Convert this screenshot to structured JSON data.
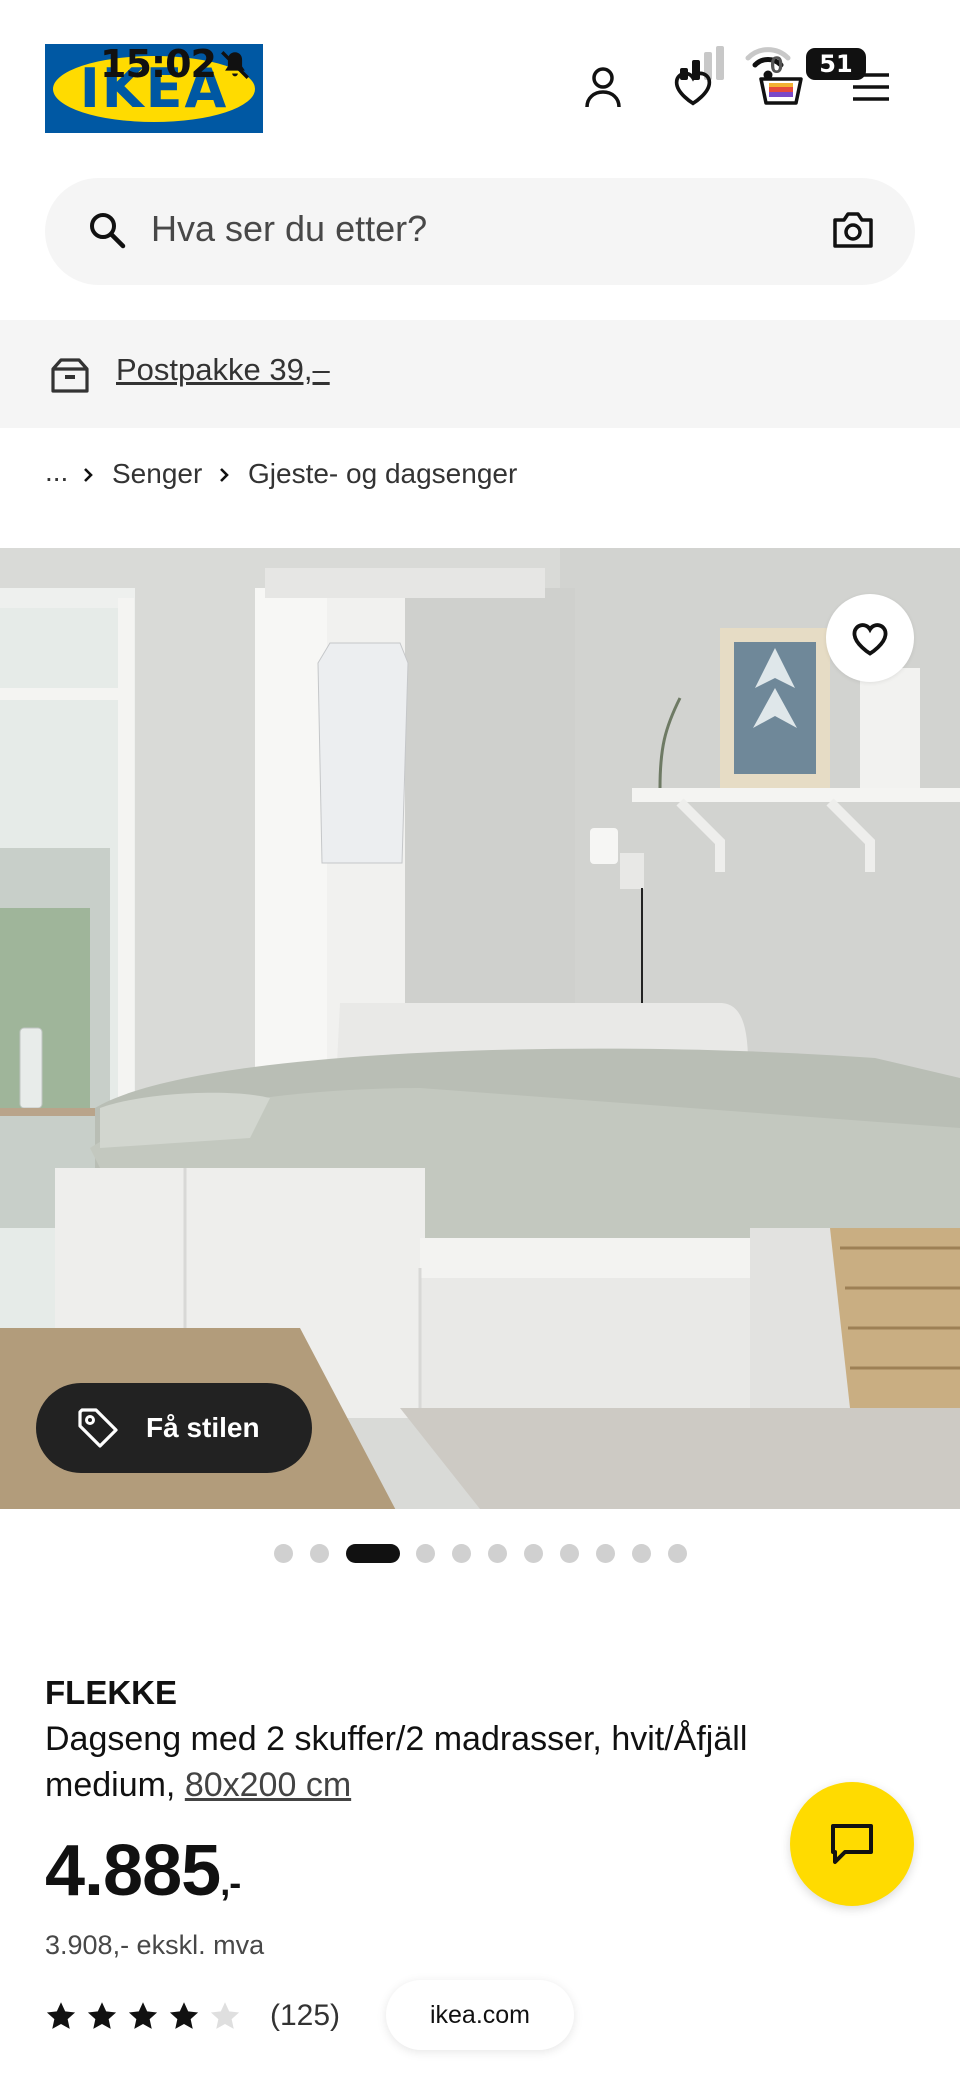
{
  "status_bar": {
    "time": "15:02",
    "battery": "51"
  },
  "header": {
    "logo_text": "IKEA",
    "cart_count": "0"
  },
  "search": {
    "placeholder": "Hva ser du etter?"
  },
  "banner": {
    "text": "Postpakke 39,–"
  },
  "breadcrumb": {
    "ellipsis": "...",
    "items": [
      "Senger",
      "Gjeste- og dagsenger"
    ]
  },
  "hero": {
    "style_button": "Få stilen",
    "dots_total": 11,
    "active_dot": 3
  },
  "product": {
    "name": "FLEKKE",
    "description": "Dagseng med 2 skuffer/2 madrasser, hvit/Åfjäll medium,",
    "size": "80x200 cm",
    "price": "4.885",
    "price_suffix": ",-",
    "price_ex_vat": "3.908,- ekskl. mva",
    "rating": 4,
    "rating_max": 5,
    "reviews": "(125)"
  },
  "browser": {
    "url": "ikea.com"
  },
  "colors": {
    "brand_blue": "#0058a3",
    "brand_yellow": "#ffdb00"
  }
}
